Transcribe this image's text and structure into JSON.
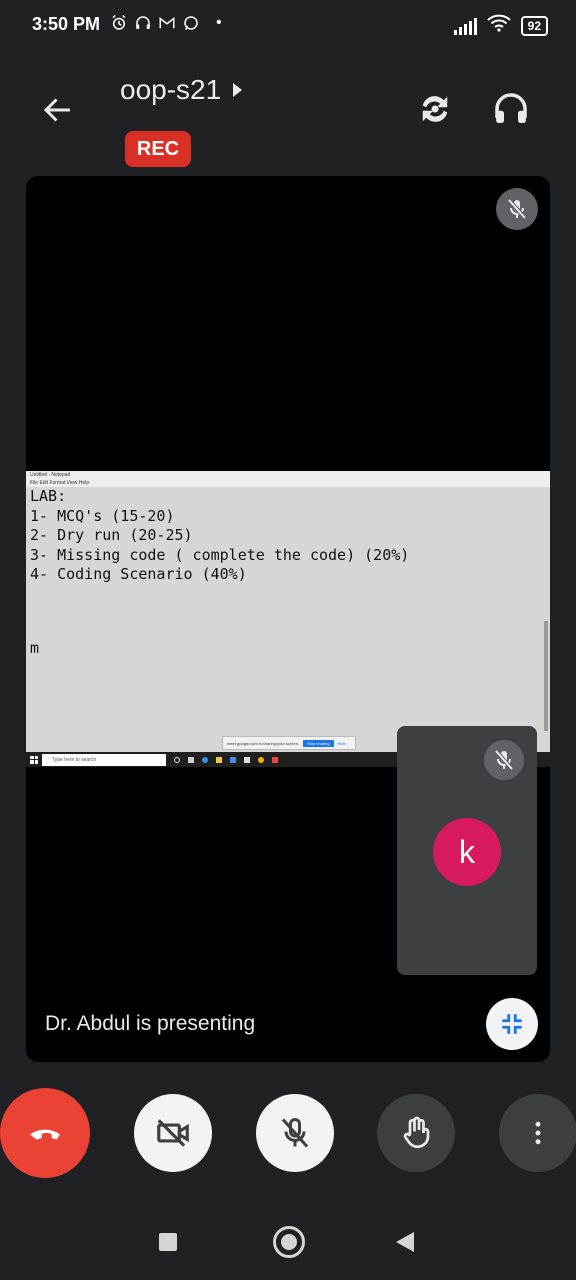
{
  "status_bar": {
    "time": "3:50 PM",
    "battery": "92",
    "dot": "•"
  },
  "header": {
    "meeting_name": "oop-s21",
    "rec_label": "REC"
  },
  "shared_screen": {
    "window_title": "Untitled - Notepad",
    "menu": "File  Edit  Format  View  Help",
    "lines": [
      "LAB:",
      "1- MCQ's (15-20)",
      "2- Dry run (20-25)",
      "3- Missing code ( complete the code) (20%)",
      "4- Coding Scenario (40%)"
    ],
    "stray_char": "m",
    "share_notice": "meet.google.com is sharing your screen.",
    "stop_sharing_label": "Stop sharing",
    "hide_label": "Hide",
    "taskbar_search": "Type here to search"
  },
  "self_tile": {
    "avatar_letter": "k"
  },
  "presenting_text": "Dr. Abdul is presenting",
  "colors": {
    "background": "#202124",
    "rec": "#d93025",
    "end_call": "#ea4335",
    "avatar": "#d81b60",
    "accent": "#1a73e8"
  }
}
